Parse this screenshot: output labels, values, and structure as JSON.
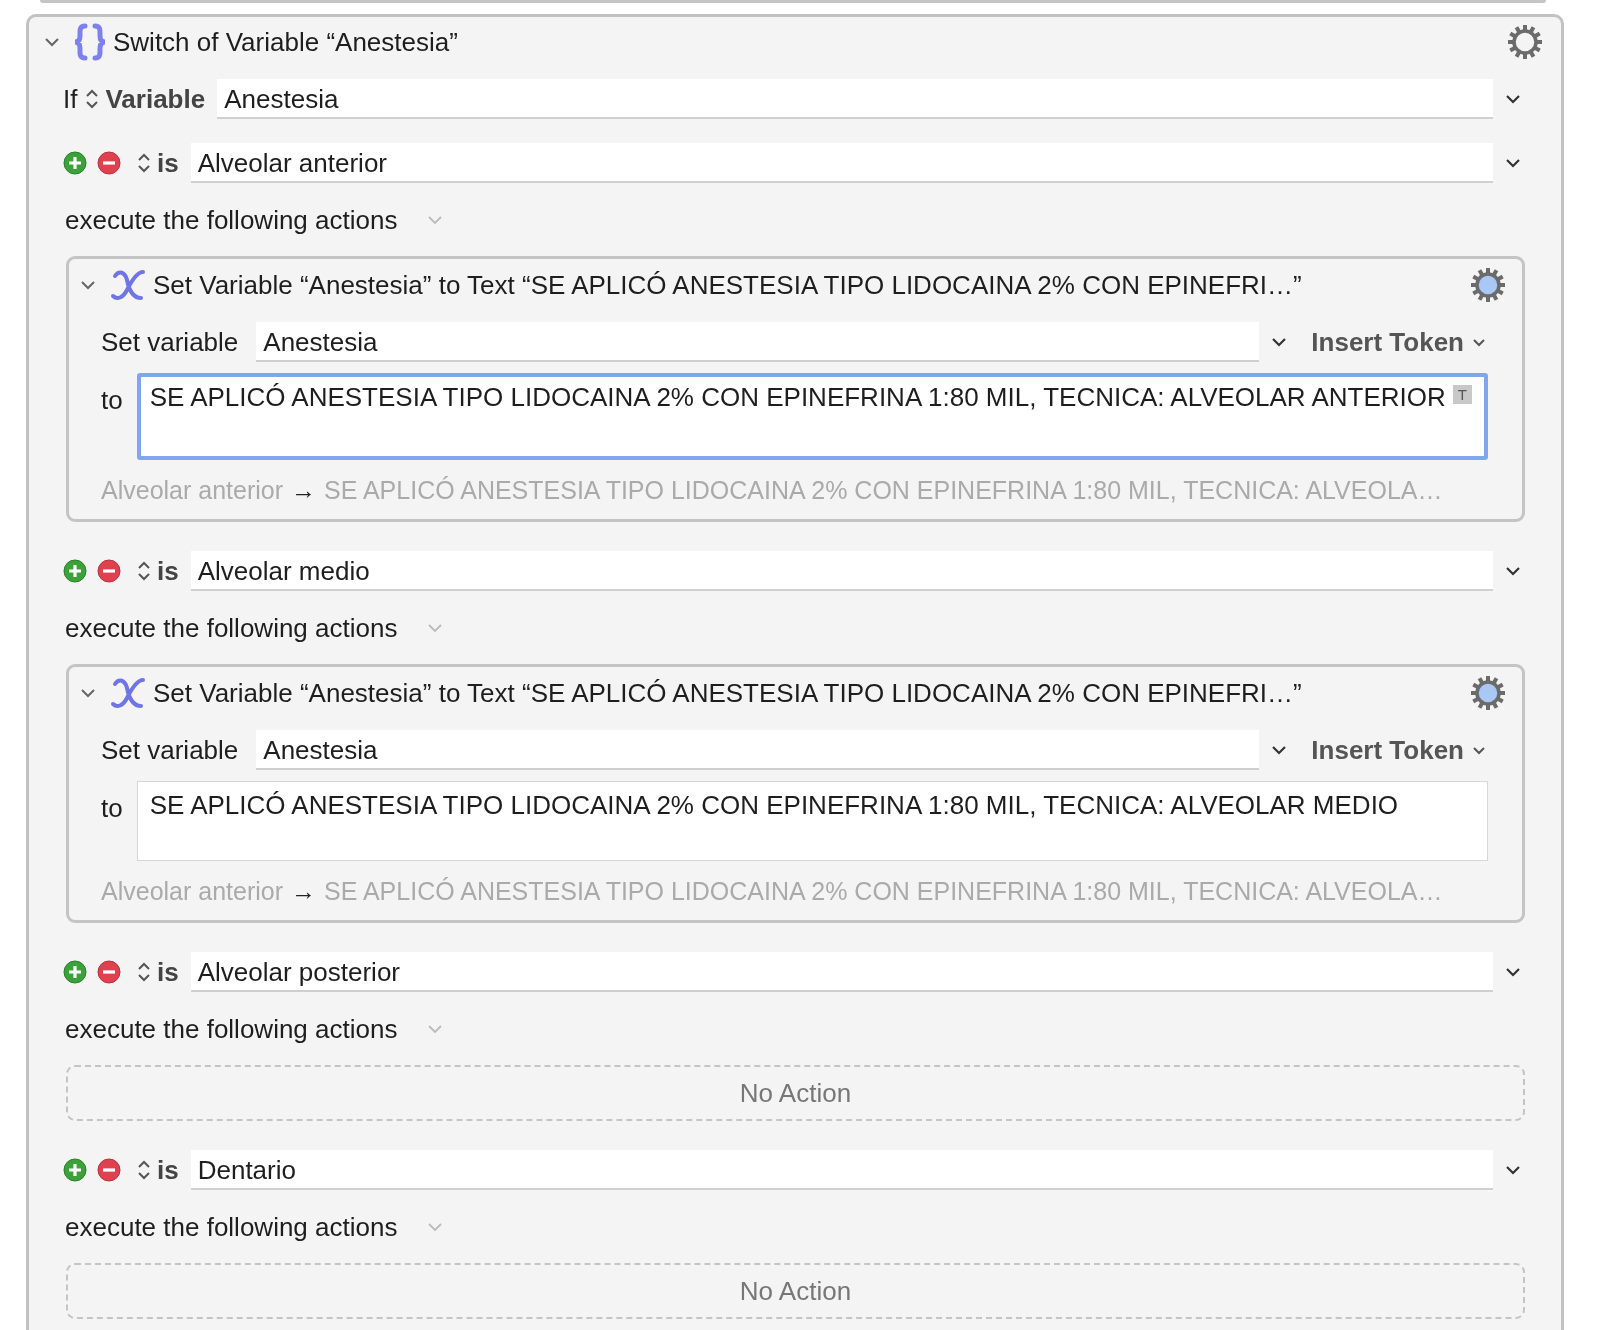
{
  "switch": {
    "title": "Switch of Variable “Anestesia”",
    "expanded": true,
    "condition_prefix": "If",
    "condition_type": "Variable",
    "variable": "Anestesia"
  },
  "cases": [
    {
      "kind": "actions",
      "operator": "is",
      "value": "Alveolar anterior",
      "execute_label": "execute the following actions",
      "actions": [
        {
          "title": "Set Variable “Anestesia” to Text “SE APLICÓ ANESTESIA TIPO LIDOCAINA 2% CON EPINEFRI…”",
          "expanded": true,
          "set_label": "Set variable",
          "variable": "Anestesia",
          "insert_token": "Insert Token",
          "to_label": "to",
          "text": "SE APLICÓ ANESTESIA TIPO LIDOCAINA 2% CON EPINEFRINA 1:80 MIL, TECNICA: ALVEOLAR ANTERIOR",
          "focused": true,
          "token_badge": "T",
          "summary_key": "Alveolar anterior",
          "summary_arrow": "→",
          "summary_value": "SE APLICÓ ANESTESIA TIPO LIDOCAINA 2% CON EPINEFRINA 1:80 MIL, TECNICA: ALVEOLA…"
        }
      ]
    },
    {
      "kind": "actions",
      "operator": "is",
      "value": "Alveolar medio",
      "execute_label": "execute the following actions",
      "actions": [
        {
          "title": "Set Variable “Anestesia” to Text “SE APLICÓ ANESTESIA TIPO LIDOCAINA 2% CON EPINEFRI…”",
          "expanded": true,
          "set_label": "Set variable",
          "variable": "Anestesia",
          "insert_token": "Insert Token",
          "to_label": "to",
          "text": "SE APLICÓ ANESTESIA TIPO LIDOCAINA 2% CON EPINEFRINA 1:80 MIL, TECNICA: ALVEOLAR MEDIO",
          "focused": false,
          "summary_key": "Alveolar anterior",
          "summary_arrow": "→",
          "summary_value": "SE APLICÓ ANESTESIA TIPO LIDOCAINA 2% CON EPINEFRINA 1:80 MIL, TECNICA: ALVEOLA…"
        }
      ]
    },
    {
      "kind": "empty",
      "operator": "is",
      "value": "Alveolar posterior",
      "execute_label": "execute the following actions",
      "empty_label": "No Action"
    },
    {
      "kind": "empty",
      "operator": "is",
      "value": "Dentario",
      "execute_label": "execute the following actions",
      "empty_label": "No Action"
    }
  ]
}
